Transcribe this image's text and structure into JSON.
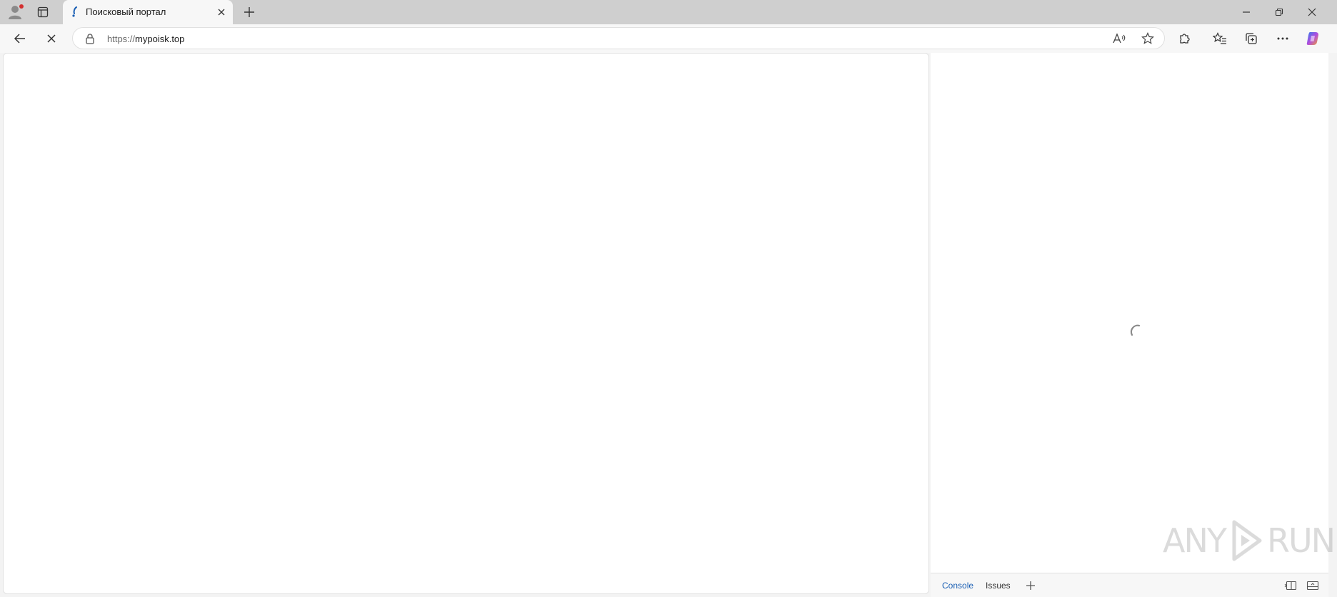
{
  "tab": {
    "title": "Поисковый портал"
  },
  "address_bar": {
    "url_scheme": "https://",
    "url_host": "mypoisk.top"
  },
  "devtools": {
    "tabs": [
      {
        "label": "Console",
        "active": true
      },
      {
        "label": "Issues",
        "active": false
      }
    ]
  },
  "watermark": {
    "left": "ANY",
    "right": "RUN"
  },
  "colors": {
    "accent": "#1a5fb4",
    "profile_badge": "#d32f2f"
  }
}
